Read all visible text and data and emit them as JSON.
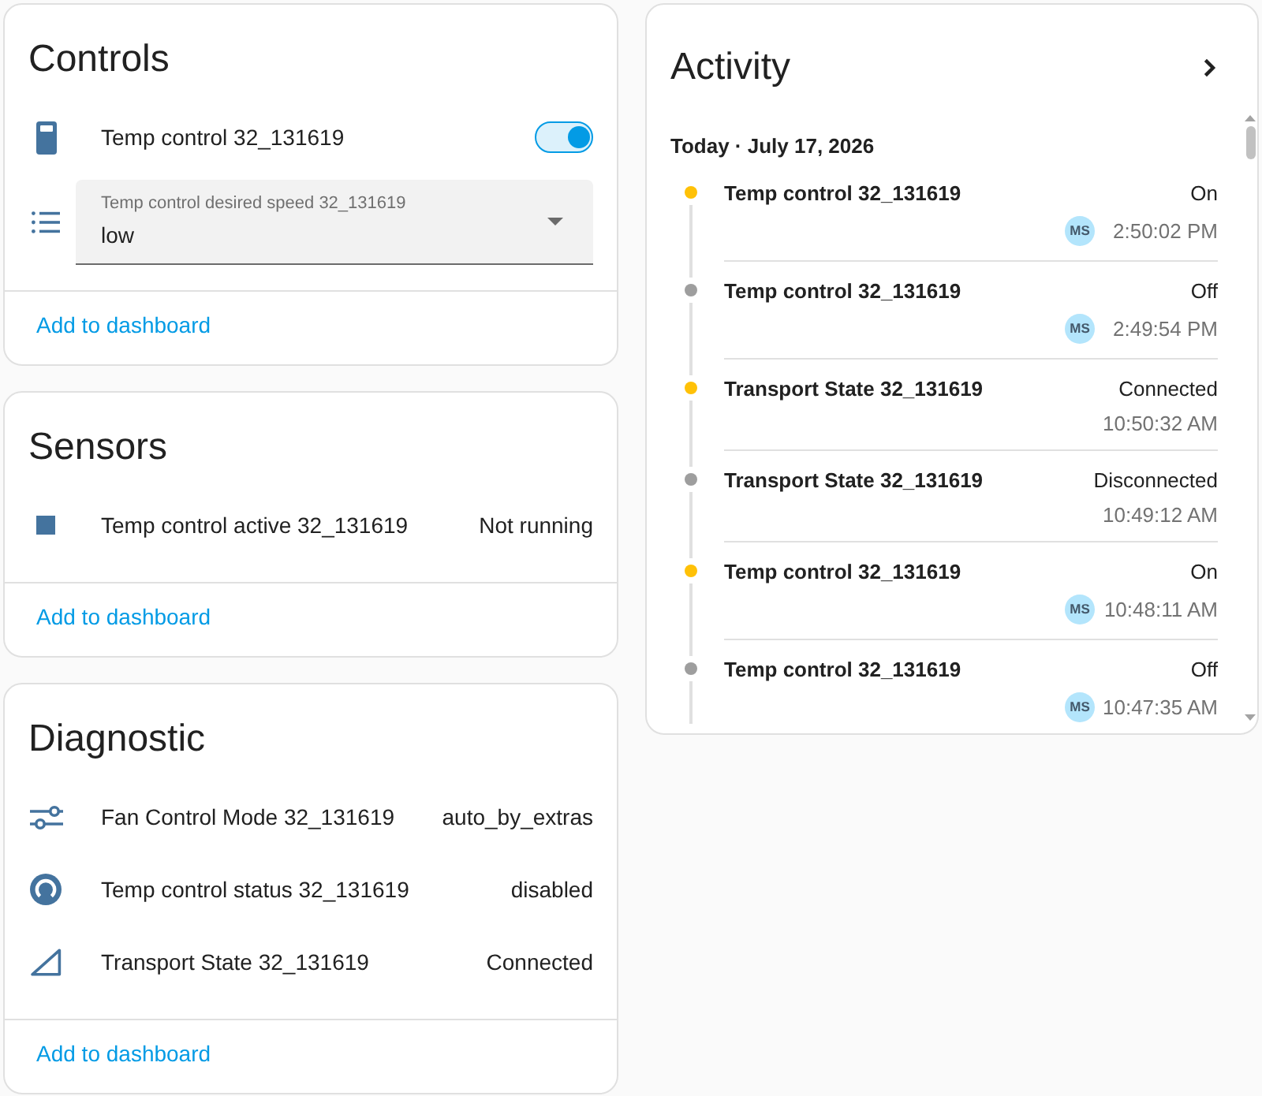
{
  "controls": {
    "title": "Controls",
    "items": [
      {
        "kind": "switch",
        "name": "Temp control 32_131619",
        "on": true
      },
      {
        "kind": "select",
        "label": "Temp control desired speed 32_131619",
        "value": "low"
      }
    ],
    "action": "Add to dashboard"
  },
  "sensors": {
    "title": "Sensors",
    "items": [
      {
        "kind": "binary",
        "name": "Temp control active 32_131619",
        "state": "Not running"
      }
    ],
    "action": "Add to dashboard"
  },
  "diagnostic": {
    "title": "Diagnostic",
    "items": [
      {
        "kind": "mode",
        "name": "Fan Control Mode 32_131619",
        "state": "auto_by_extras"
      },
      {
        "kind": "status",
        "name": "Temp control status 32_131619",
        "state": "disabled"
      },
      {
        "kind": "connection",
        "name": "Transport State 32_131619",
        "state": "Connected"
      }
    ],
    "action": "Add to dashboard"
  },
  "activity": {
    "title": "Activity",
    "date": "Today · July 17, 2026",
    "entries": [
      {
        "name": "Temp control 32_131619",
        "state": "On",
        "color": "#ffc107",
        "user": "MS",
        "time": "2:50:02 PM"
      },
      {
        "name": "Temp control 32_131619",
        "state": "Off",
        "color": "#9e9e9e",
        "user": "MS",
        "time": "2:49:54 PM"
      },
      {
        "name": "Transport State 32_131619",
        "state": "Connected",
        "color": "#ffc107",
        "time": "10:50:32 AM"
      },
      {
        "name": "Transport State 32_131619",
        "state": "Disconnected",
        "color": "#9e9e9e",
        "time": "10:49:12 AM"
      },
      {
        "name": "Temp control 32_131619",
        "state": "On",
        "color": "#ffc107",
        "user": "MS",
        "time": "10:48:11 AM"
      },
      {
        "name": "Temp control 32_131619",
        "state": "Off",
        "color": "#9e9e9e",
        "user": "MS",
        "time": "10:47:35 AM"
      }
    ]
  }
}
